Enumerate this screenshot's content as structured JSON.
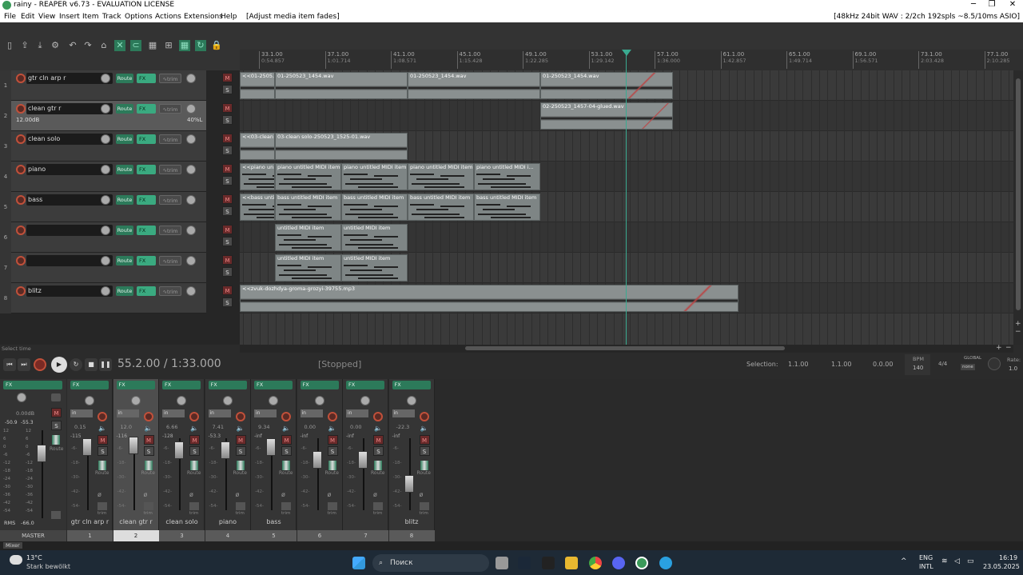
{
  "window": {
    "title": "rainy - REAPER v6.73 - EVALUATION LICENSE"
  },
  "menu": {
    "items": [
      "File",
      "Edit",
      "View",
      "Insert",
      "Item",
      "Track",
      "Options",
      "Actions",
      "Extensions",
      "Help",
      "[Adjust media item fades]"
    ],
    "status": "[48kHz 24bit WAV : 2/2ch 192spls ~8.5/10ms ASIO]"
  },
  "ruler": [
    {
      "bar": "33.1.00",
      "time": "0:54.857"
    },
    {
      "bar": "37.1.00",
      "time": "1:01.714"
    },
    {
      "bar": "41.1.00",
      "time": "1:08.571"
    },
    {
      "bar": "45.1.00",
      "time": "1:15.428"
    },
    {
      "bar": "49.1.00",
      "time": "1:22.285"
    },
    {
      "bar": "53.1.00",
      "time": "1:29.142"
    },
    {
      "bar": "57.1.00",
      "time": "1:36.000"
    },
    {
      "bar": "61.1.00",
      "time": "1:42.857"
    },
    {
      "bar": "65.1.00",
      "time": "1:49.714"
    },
    {
      "bar": "69.1.00",
      "time": "1:56.571"
    },
    {
      "bar": "73.1.00",
      "time": "2:03.428"
    },
    {
      "bar": "77.1.00",
      "time": "2:10.285"
    }
  ],
  "tracks": [
    {
      "num": "1",
      "name": "gtr cln arp  r"
    },
    {
      "num": "2",
      "name": "clean gtr r",
      "vol": "12.00dB",
      "pan": "40%L"
    },
    {
      "num": "3",
      "name": "clean solo"
    },
    {
      "num": "4",
      "name": "piano"
    },
    {
      "num": "5",
      "name": "bass"
    },
    {
      "num": "6",
      "name": ""
    },
    {
      "num": "7",
      "name": ""
    },
    {
      "num": "8",
      "name": "blitz"
    }
  ],
  "tcp_labels": {
    "route": "Route",
    "fx": "FX",
    "trim": "trim",
    "m": "M",
    "s": "S"
  },
  "items": {
    "t1": [
      "<<01-2505...",
      "01-250523_1454.wav",
      "01-250523_1454.wav",
      "01-250523_1454.wav"
    ],
    "t2": [
      "02-250523_1457-04-glued.wav"
    ],
    "t3": [
      "<<03-clean ...",
      "03-clean solo-250523_1525-01.wav"
    ],
    "t4": [
      "<<piano un...",
      "piano untitled MIDI item",
      "piano untitled MIDI item",
      "piano untitled MIDI item",
      "piano untitled MIDI i..."
    ],
    "t5": [
      "<<bass unti...",
      "bass untitled MIDI item",
      "bass untitled MIDI item",
      "bass untitled MIDI item",
      "bass untitled MIDI item"
    ],
    "t6": [
      "untitled MIDI item",
      "untitled MIDI item"
    ],
    "t7": [
      "untitled MIDI item",
      "untitled MIDI item"
    ],
    "t8": [
      "<<zvuk-dozhdya-groma-grozyi-39755.mp3"
    ]
  },
  "transport": {
    "select_time": "Select time",
    "position": "55.2.00 / 1:33.000",
    "state": "[Stopped]",
    "selection_label": "Selection:",
    "sel_start": "1.1.00",
    "sel_end": "1.1.00",
    "sel_len": "0.0.00",
    "bpm_label": "BPM",
    "bpm": "140",
    "timesig": "4/4",
    "global": "GLOBAL",
    "none": "none",
    "rate_label": "Rate:",
    "rate": "1.0"
  },
  "master": {
    "vol": "0.00dB",
    "peakL": "-50.9",
    "peakR": "-55.3",
    "rms_label": "RMS",
    "rms": "-66.0",
    "name": "MASTER",
    "scale": [
      "12",
      "6",
      "0",
      "-6",
      "-12",
      "-18",
      "-24",
      "-30",
      "-36",
      "-42",
      "-54"
    ]
  },
  "strips": [
    {
      "num": "1",
      "name": "gtr cln arp  r",
      "val": "0.15",
      "peak": "-115"
    },
    {
      "num": "2",
      "name": "clean gtr r",
      "val": "12.0",
      "peak": "-116"
    },
    {
      "num": "3",
      "name": "clean solo",
      "val": "6.66",
      "peak": "-128"
    },
    {
      "num": "4",
      "name": "piano",
      "val": "7.41",
      "peak": "-53.3"
    },
    {
      "num": "5",
      "name": "bass",
      "val": "9.34",
      "peak": "-inf"
    },
    {
      "num": "6",
      "name": "",
      "val": "0.00",
      "peak": "-inf"
    },
    {
      "num": "7",
      "name": "",
      "val": "0.00",
      "peak": "-inf"
    },
    {
      "num": "8",
      "name": "blitz",
      "val": "-22.3",
      "peak": "-inf"
    }
  ],
  "strip_labels": {
    "in": "in",
    "route": "Route",
    "trim": "trim",
    "fx": "FX"
  },
  "mixer_tab": "Mixer",
  "taskbar": {
    "weather_temp": "13°C",
    "weather_desc": "Stark bewölkt",
    "search": "Поиск",
    "lang1": "ENG",
    "lang2": "INTL",
    "time": "16:19",
    "date": "23.05.2025"
  }
}
